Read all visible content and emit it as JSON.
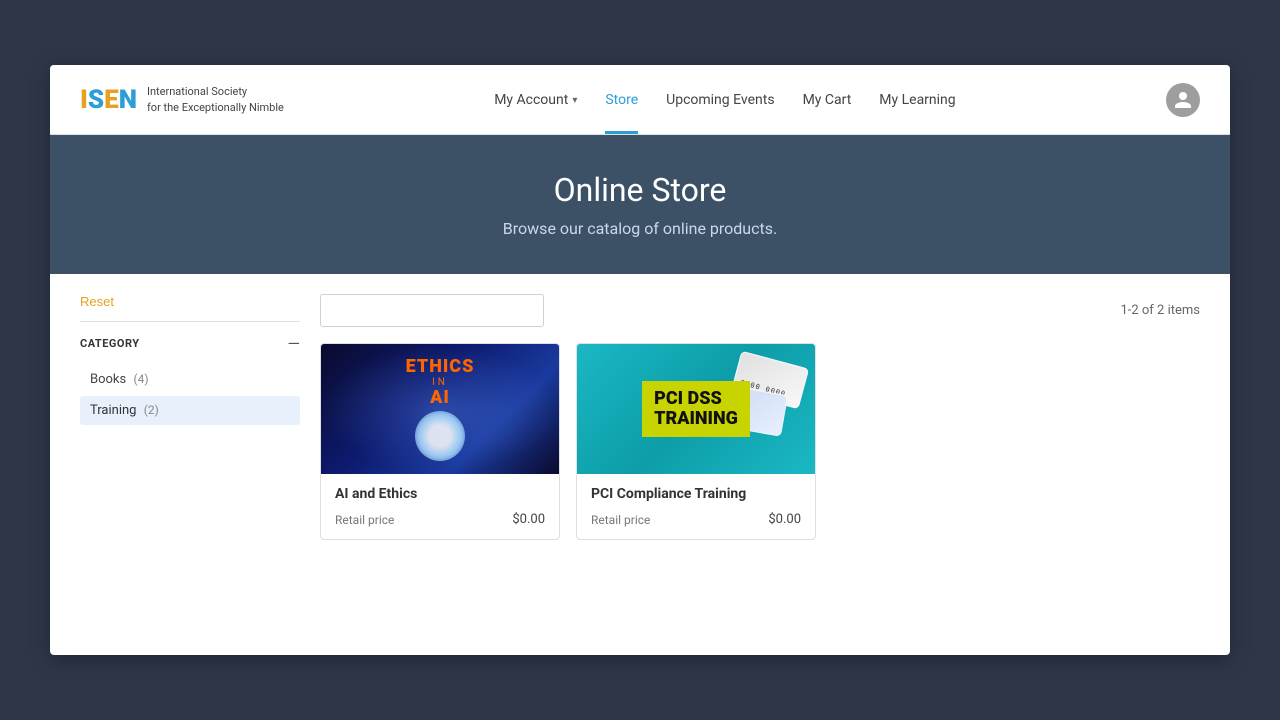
{
  "logo": {
    "letters": [
      "I",
      "S",
      "E",
      "N"
    ],
    "tagline_line1": "International Society",
    "tagline_line2": "for the Exceptionally Nimble"
  },
  "nav": {
    "my_account": "My Account",
    "store": "Store",
    "upcoming_events": "Upcoming Events",
    "my_cart": "My Cart",
    "my_learning": "My Learning"
  },
  "hero": {
    "title": "Online Store",
    "subtitle": "Browse our catalog of online products."
  },
  "sidebar": {
    "reset_label": "Reset",
    "category_label": "CATEGORY",
    "categories": [
      {
        "name": "Books",
        "count": 4,
        "active": false
      },
      {
        "name": "Training",
        "count": 2,
        "active": true
      }
    ]
  },
  "search": {
    "placeholder": "",
    "icon": "search-icon"
  },
  "results": {
    "count_label": "1-2 of 2 items"
  },
  "products": [
    {
      "id": "ai-ethics",
      "name": "AI and Ethics",
      "price_label": "Retail price",
      "price": "$0.00",
      "image_type": "ai-ethics"
    },
    {
      "id": "pci-training",
      "name": "PCI Compliance Training",
      "price_label": "Retail price",
      "price": "$0.00",
      "image_type": "pci"
    }
  ]
}
